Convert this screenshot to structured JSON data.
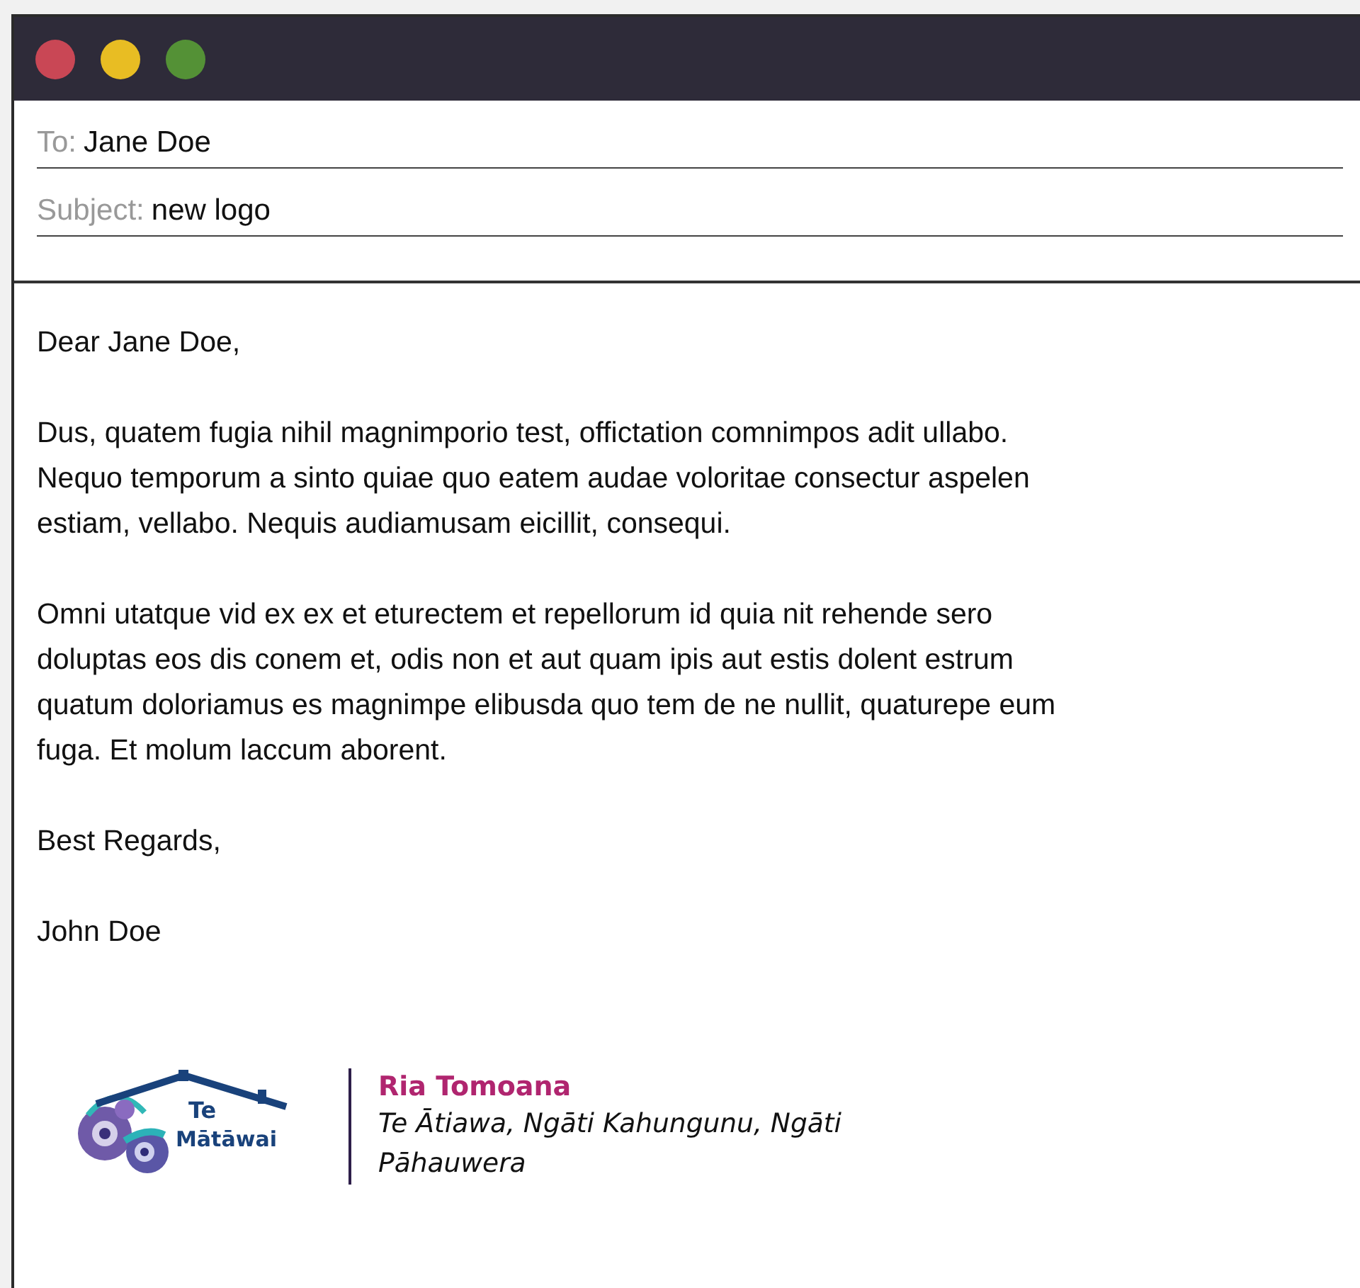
{
  "window": {
    "controls": [
      {
        "color": "#c94755"
      },
      {
        "color": "#e8bd23"
      },
      {
        "color": "#549136"
      }
    ]
  },
  "header": {
    "fields": [
      {
        "label": "To:",
        "value": "Jane Doe"
      },
      {
        "label": "Subject:",
        "value": "new logo"
      }
    ]
  },
  "body": {
    "paragraphs": [
      "Dear Jane Doe,",
      "Dus, quatem fugia nihil magnimporio test, offictation comnimpos adit ullabo. Nequo temporum a sinto quiae quo eatem audae voloritae consectur aspelen estiam, vellabo. Nequis audiamusam eicillit, consequi.",
      "Omni utatque vid ex ex et eturectem et repellorum id quia nit rehende sero doluptas eos dis conem et, odis non et aut quam ipis aut estis dolent estrum quatum doloriamus es magnimpe elibusda quo tem de ne nullit, quaturepe eum fuga. Et molum laccum aborent.",
      "Best Regards,",
      "John Doe"
    ]
  },
  "signature": {
    "logo": {
      "line_1": "Te",
      "line_2": "Mātāwai"
    },
    "name": "Ria Tomoana",
    "affiliation": "Te Ātiawa, Ngāti Kahungunu, Ngāti Pāhauwera"
  }
}
